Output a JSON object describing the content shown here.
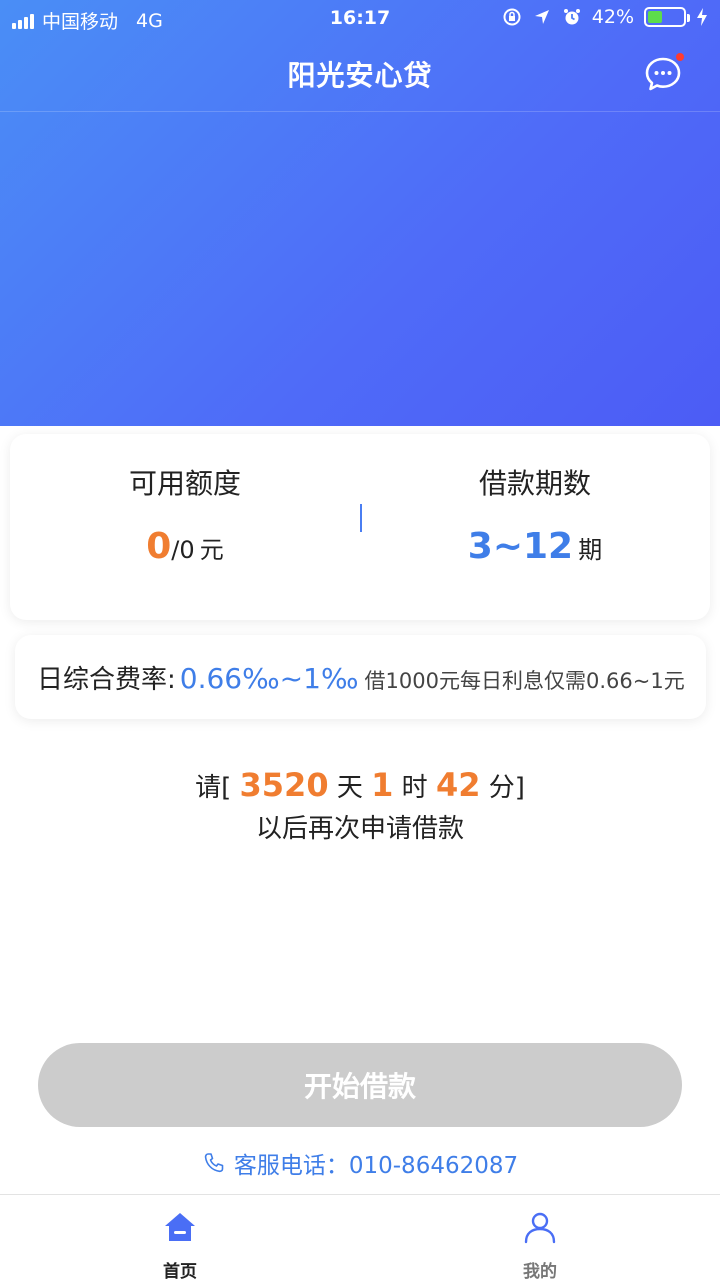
{
  "status_bar": {
    "carrier": "中国移动",
    "network": "4G",
    "time": "16:17",
    "battery": "42%",
    "battery_level": 0.42,
    "icons": [
      "signal-icon",
      "rotation-lock-icon",
      "location-icon",
      "alarm-icon",
      "battery-icon",
      "charging-icon"
    ]
  },
  "nav": {
    "title": "阳光安心贷",
    "message_icon": "chat-bubble-icon"
  },
  "quota": {
    "label": "可用额度",
    "available": "0",
    "separator_total": "/0",
    "unit": "元"
  },
  "period": {
    "label": "借款期数",
    "range": "3~12",
    "unit": "期"
  },
  "rate": {
    "label": "日综合费率:",
    "value": "0.66‰~1‰",
    "note": "借1000元每日利息仅需0.66~1元"
  },
  "countdown": {
    "prefix": "请[",
    "days": "3520",
    "days_unit": "天",
    "hours": "1",
    "hours_unit": "时",
    "minutes": "42",
    "minutes_unit": "分]",
    "suffix": "以后再次申请借款"
  },
  "start_button": "开始借款",
  "hotline": {
    "icon": "phone-icon",
    "text": "客服电话：010-86462087"
  },
  "tabs": [
    {
      "label": "首页",
      "icon": "home-icon",
      "active": true
    },
    {
      "label": "我的",
      "icon": "user-icon",
      "active": false
    }
  ],
  "colors": {
    "brand_blue": "#4f6bf8",
    "accent_orange": "#f07d30",
    "link_blue": "#3f7ee8",
    "disabled_button": "#cccccc"
  }
}
